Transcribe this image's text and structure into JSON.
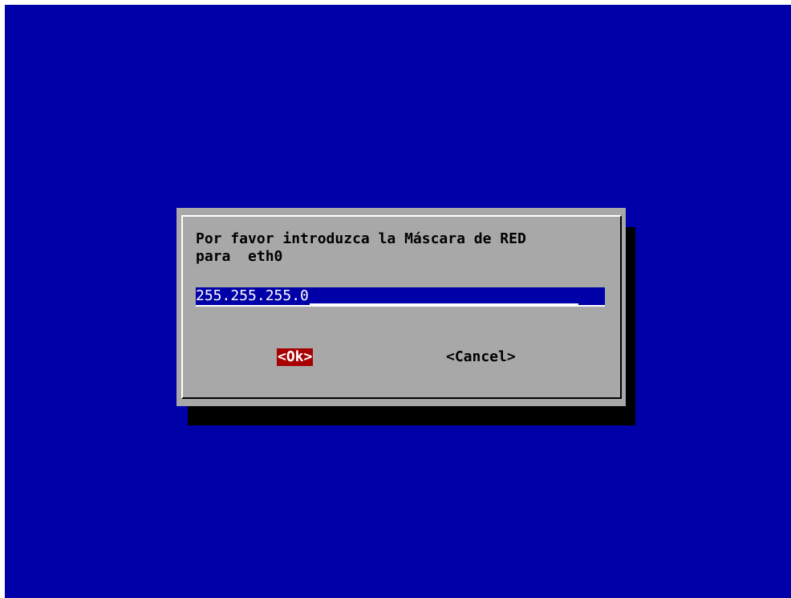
{
  "dialog": {
    "prompt_line1": "Por favor introduzca la Máscara de RED",
    "prompt_line2": "para  eth0",
    "input_value": "255.255.255.0",
    "ok_label": "<Ok>",
    "cancel_label": "<Cancel>"
  },
  "colors": {
    "background": "#0000a8",
    "dialog": "#a8a8a8",
    "selected_button": "#a80000",
    "shadow": "#000000"
  }
}
